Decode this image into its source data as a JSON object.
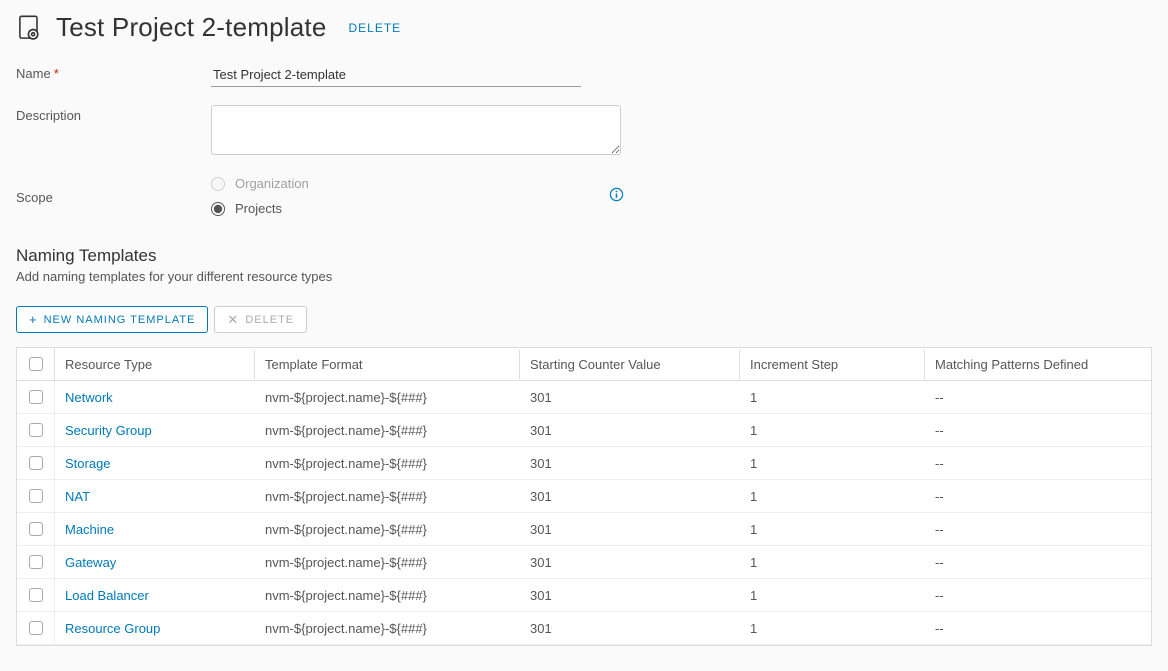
{
  "header": {
    "title": "Test Project 2-template",
    "delete_label": "DELETE"
  },
  "form": {
    "name_label": "Name",
    "name_value": "Test Project 2-template",
    "description_label": "Description",
    "description_value": "",
    "scope_label": "Scope",
    "scope_options": {
      "organization": "Organization",
      "projects": "Projects"
    }
  },
  "section": {
    "title": "Naming Templates",
    "subtitle": "Add naming templates for your different resource types"
  },
  "buttons": {
    "new_template": "NEW NAMING TEMPLATE",
    "delete": "DELETE"
  },
  "table": {
    "headers": {
      "resource_type": "Resource Type",
      "template_format": "Template Format",
      "starting_counter": "Starting Counter Value",
      "increment_step": "Increment Step",
      "matching_patterns": "Matching Patterns Defined"
    },
    "rows": [
      {
        "resource_type": "Network",
        "template_format": "nvm-${project.name}-${###}",
        "starting_counter": "301",
        "increment_step": "1",
        "matching_patterns": "--"
      },
      {
        "resource_type": "Security Group",
        "template_format": "nvm-${project.name}-${###}",
        "starting_counter": "301",
        "increment_step": "1",
        "matching_patterns": "--"
      },
      {
        "resource_type": "Storage",
        "template_format": "nvm-${project.name}-${###}",
        "starting_counter": "301",
        "increment_step": "1",
        "matching_patterns": "--"
      },
      {
        "resource_type": "NAT",
        "template_format": "nvm-${project.name}-${###}",
        "starting_counter": "301",
        "increment_step": "1",
        "matching_patterns": "--"
      },
      {
        "resource_type": "Machine",
        "template_format": "nvm-${project.name}-${###}",
        "starting_counter": "301",
        "increment_step": "1",
        "matching_patterns": "--"
      },
      {
        "resource_type": "Gateway",
        "template_format": "nvm-${project.name}-${###}",
        "starting_counter": "301",
        "increment_step": "1",
        "matching_patterns": "--"
      },
      {
        "resource_type": "Load Balancer",
        "template_format": "nvm-${project.name}-${###}",
        "starting_counter": "301",
        "increment_step": "1",
        "matching_patterns": "--"
      },
      {
        "resource_type": "Resource Group",
        "template_format": "nvm-${project.name}-${###}",
        "starting_counter": "301",
        "increment_step": "1",
        "matching_patterns": "--"
      }
    ]
  }
}
